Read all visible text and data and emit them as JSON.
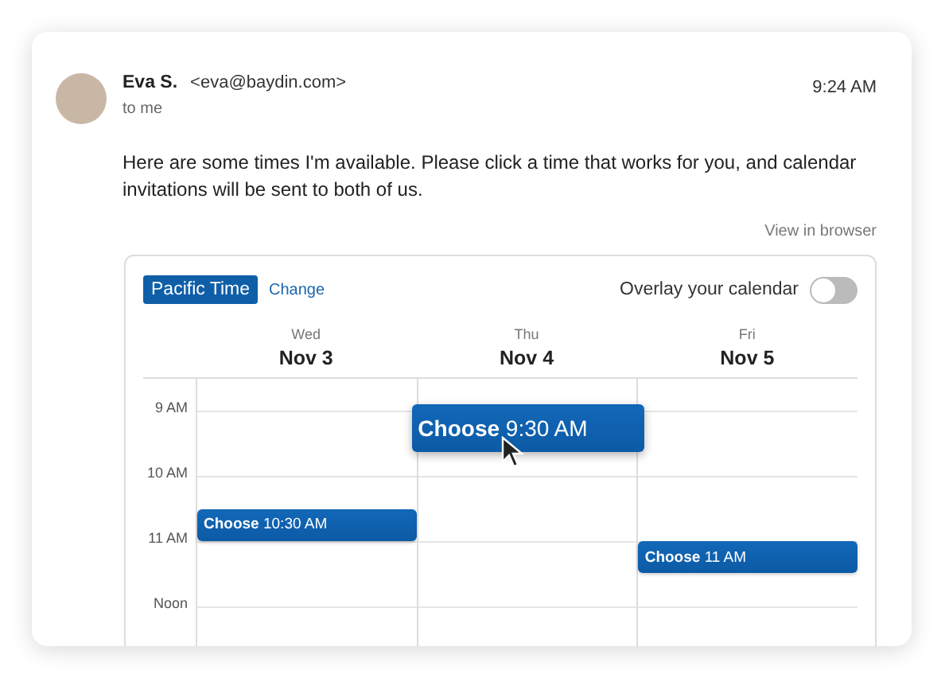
{
  "email": {
    "sender_name": "Eva S.",
    "sender_email": "<eva@baydin.com>",
    "recipient": "to me",
    "time": "9:24 AM",
    "body": "Here are some times I'm available. Please click a time that works for you, and calendar invitations will be sent to both of us.",
    "view_link": "View in browser"
  },
  "scheduler": {
    "timezone": "Pacific Time",
    "change_link": "Change",
    "overlay": {
      "label": "Overlay your calendar",
      "on": false
    },
    "hours": [
      "9 AM",
      "10 AM",
      "11 AM",
      "Noon"
    ],
    "days": [
      {
        "weekday": "Wed",
        "date": "Nov 3",
        "slots": [
          {
            "action": "Choose",
            "time": "10:30 AM",
            "hovered": false
          }
        ]
      },
      {
        "weekday": "Thu",
        "date": "Nov 4",
        "slots": [
          {
            "action": "Choose",
            "time": "9:30 AM",
            "hovered": true
          }
        ]
      },
      {
        "weekday": "Fri",
        "date": "Nov 5",
        "slots": [
          {
            "action": "Choose",
            "time": "11 AM",
            "hovered": false
          }
        ]
      }
    ]
  }
}
